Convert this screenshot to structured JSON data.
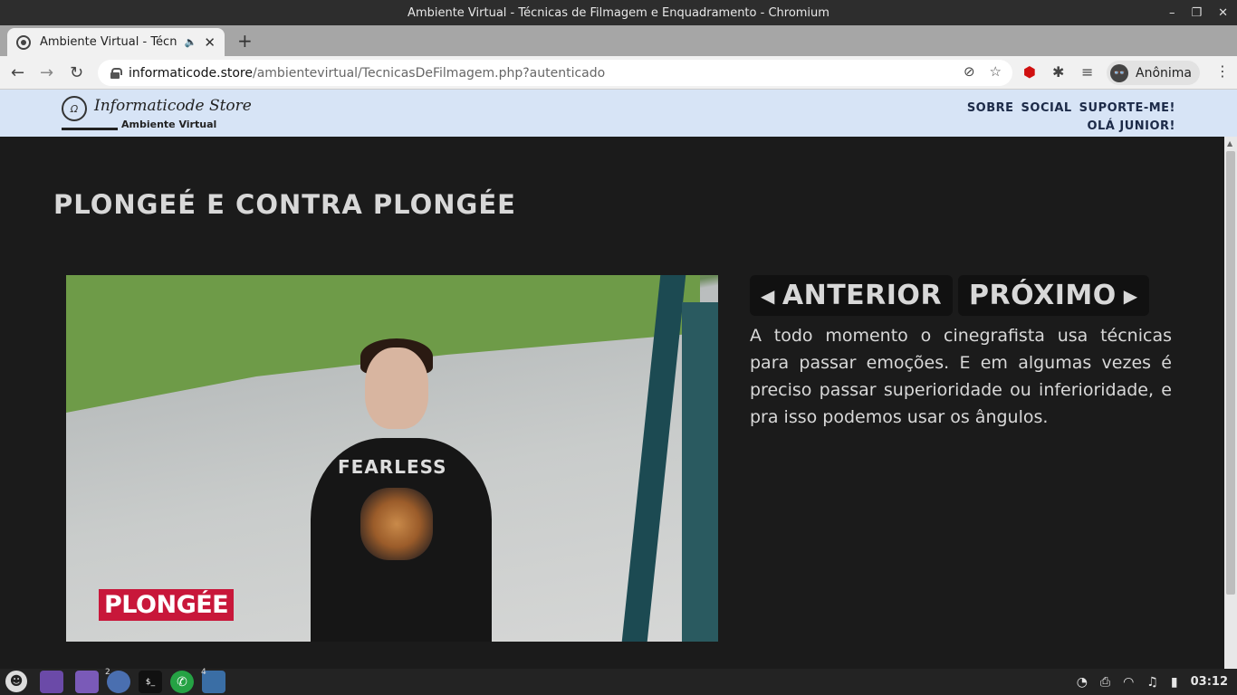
{
  "window": {
    "title": "Ambiente Virtual - Técnicas de Filmagem e Enquadramento - Chromium",
    "controls": [
      "–",
      "❐",
      "✕"
    ]
  },
  "tab": {
    "title": "Ambiente Virtual - Técnica",
    "audio_icon": "🔈",
    "close": "✕",
    "new_tab": "+"
  },
  "toolbar": {
    "back": "←",
    "forward": "→",
    "reload": "↻",
    "url_host": "informaticode.store",
    "url_path": "/ambientevirtual/TecnicasDeFilmagem.php?autenticado",
    "tracking_icon": "⊘",
    "bookmark_icon": "☆",
    "extension_icon": "⬢",
    "puzzle_icon": "✱",
    "media_icon": "≡",
    "profile_label": "Anônima",
    "profile_glyph": "👓",
    "menu_icon": "⋮"
  },
  "site": {
    "logo_mark": "Ω",
    "logo_name": "Informaticode Store",
    "logo_sub": "Ambiente Virtual",
    "nav": [
      "SOBRE",
      "SOCIAL",
      "SUPORTE-ME!"
    ],
    "greeting": "OLÁ JUNIOR!"
  },
  "page": {
    "title": "PLONGEÉ E CONTRA PLONGÉE",
    "video": {
      "shirt_text": "FEARLESS",
      "caption": "PLONGÉE"
    },
    "prev_label": "ANTERIOR",
    "prev_arrow": "◀",
    "next_label": "PRÓXIMO",
    "next_arrow": "▶",
    "description": "A todo momento o cinegrafista usa técnicas para passar emoções. E em algumas vezes é preciso passar superioridade ou inferioridade, e pra isso podemos usar os ângulos."
  },
  "taskbar": {
    "badge_browser": "2",
    "badge_camera": "4",
    "terminal_glyph": "$_",
    "clock": "03:12",
    "tray": [
      "◔",
      "⎙",
      "◠",
      "♫",
      "▮"
    ]
  },
  "colors": {
    "site_header_bg": "#d7e4f6",
    "page_bg": "#1b1b1b",
    "caption_bg": "#c8173a",
    "nav_text": "#1c2a48"
  }
}
